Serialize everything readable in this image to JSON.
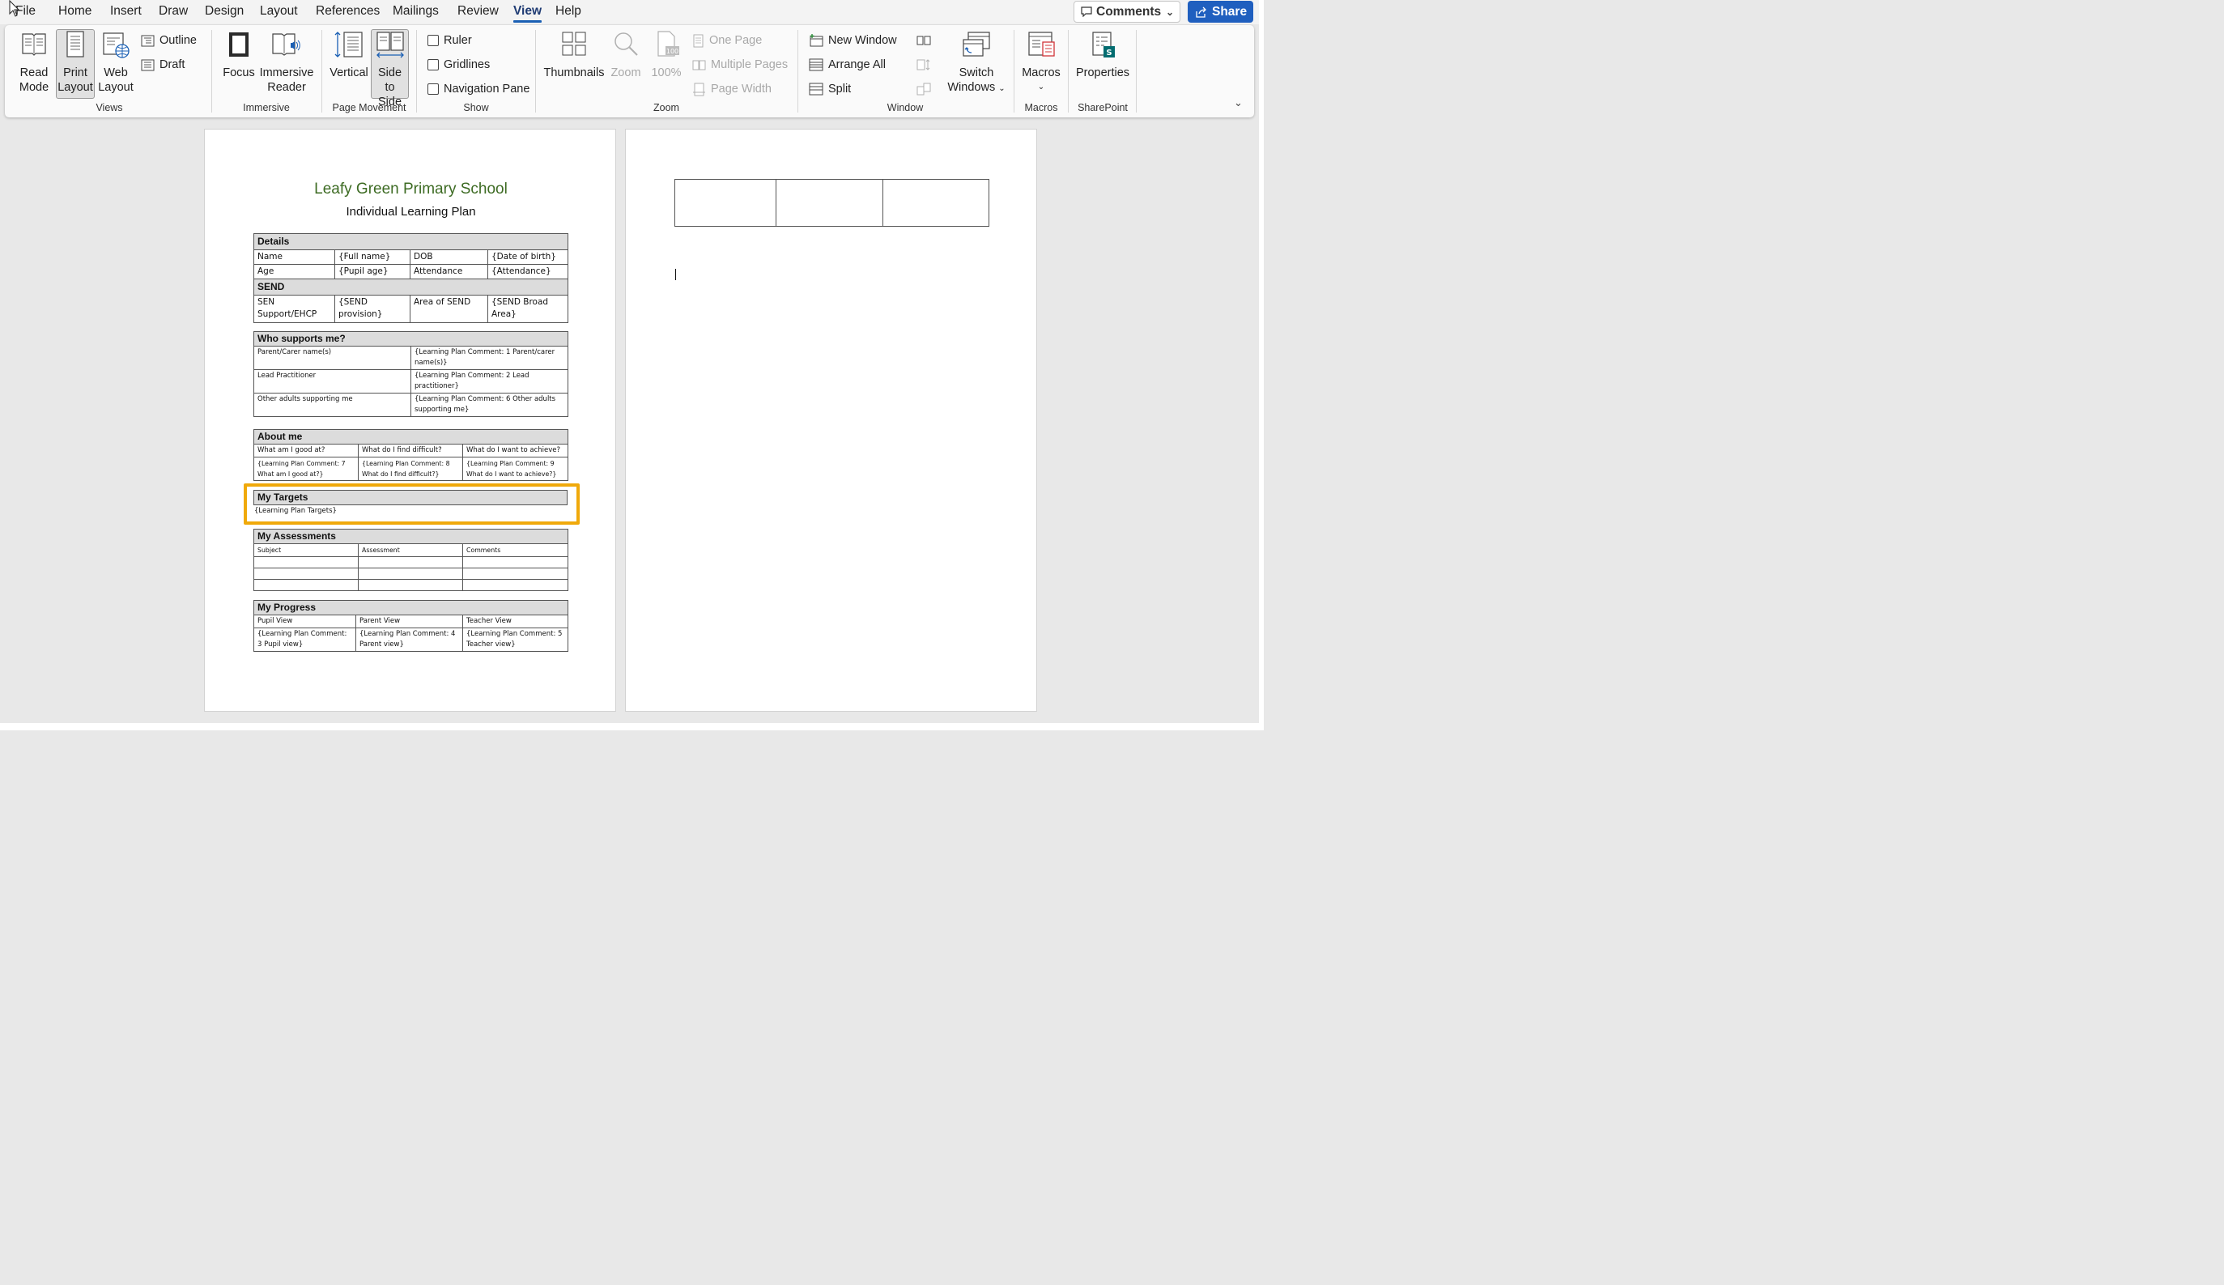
{
  "menu": {
    "file": "File",
    "home": "Home",
    "insert": "Insert",
    "draw": "Draw",
    "design": "Design",
    "layout": "Layout",
    "references": "References",
    "mailings": "Mailings",
    "review": "Review",
    "view": "View",
    "help": "Help",
    "active_tab": "View",
    "comments": "Comments",
    "share": "Share"
  },
  "ribbon": {
    "views": {
      "read_mode": [
        "Read",
        "Mode"
      ],
      "print_layout": [
        "Print",
        "Layout"
      ],
      "web_layout": [
        "Web",
        "Layout"
      ],
      "outline": "Outline",
      "draft": "Draft",
      "label": "Views"
    },
    "immersive": {
      "focus": "Focus",
      "immersive_reader": [
        "Immersive",
        "Reader"
      ],
      "label": "Immersive"
    },
    "page_movement": {
      "vertical": "Vertical",
      "side_to_side": [
        "Side",
        "to Side"
      ],
      "label": "Page Movement"
    },
    "show": {
      "ruler": "Ruler",
      "gridlines": "Gridlines",
      "navigation_pane": "Navigation Pane",
      "label": "Show"
    },
    "zoom": {
      "thumbnails": "Thumbnails",
      "zoom": "Zoom",
      "percent": "100%",
      "one_page": "One Page",
      "multiple_pages": "Multiple Pages",
      "page_width": "Page Width",
      "label": "Zoom"
    },
    "window": {
      "new_window": "New Window",
      "arrange_all": "Arrange All",
      "split": "Split",
      "switch_windows": [
        "Switch",
        "Windows"
      ],
      "label": "Window"
    },
    "macros": {
      "macros": "Macros",
      "label": "Macros"
    },
    "sharepoint": {
      "properties": "Properties",
      "label": "SharePoint"
    }
  },
  "document": {
    "school": "Leafy Green Primary School",
    "subtitle": "Individual Learning Plan",
    "details": {
      "header": "Details",
      "rows": [
        [
          "Name",
          "{Full name}",
          "DOB",
          "{Date of birth}"
        ],
        [
          "Age",
          "{Pupil age}",
          "Attendance",
          "{Attendance}"
        ]
      ],
      "send_header": "SEND",
      "send_row": [
        "SEN Support/EHCP",
        "{SEND provision}",
        "Area of SEND",
        "{SEND Broad Area}"
      ]
    },
    "supports": {
      "header": "Who supports me?",
      "rows": [
        [
          "Parent/Carer name(s)",
          "{Learning Plan Comment: 1 Parent/carer name(s)}"
        ],
        [
          "Lead Practitioner",
          "{Learning Plan Comment: 2 Lead practitioner}"
        ],
        [
          "Other adults supporting me",
          "{Learning Plan Comment: 6 Other adults supporting me}"
        ]
      ]
    },
    "about": {
      "header": "About me",
      "questions": [
        "What am I good at?",
        "What do I find difficult?",
        "What do I want to achieve?"
      ],
      "answers": [
        "{Learning Plan Comment: 7 What am I good at?}",
        "{Learning Plan Comment: 8 What do I find difficult?}",
        "{Learning Plan Comment: 9 What do I want to achieve?}"
      ]
    },
    "targets": {
      "header": "My Targets",
      "value": "{Learning Plan Targets}"
    },
    "assessments": {
      "header": "My Assessments",
      "columns": [
        "Subject",
        "Assessment",
        "Comments"
      ]
    },
    "progress": {
      "header": "My Progress",
      "columns": [
        "Pupil View",
        "Parent View",
        "Teacher View"
      ],
      "values": [
        "{Learning Plan Comment: 3 Pupil view}",
        "{Learning Plan Comment: 4 Parent view}",
        "{Learning Plan Comment: 5 Teacher view}"
      ]
    }
  },
  "colors": {
    "accent": "#1a5fb4",
    "share": "#1f5fbf",
    "highlight": "#f0a90a",
    "title_green": "#3d6b23"
  }
}
